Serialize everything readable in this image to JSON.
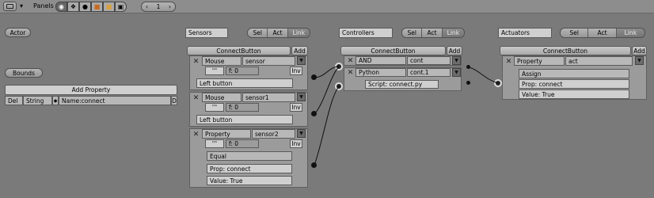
{
  "toolbar": {
    "window_icon": "window-type-icon",
    "panels_label": "Panels",
    "page_value": "1"
  },
  "actor": {
    "actor_button": "Actor",
    "bounds_button": "Bounds"
  },
  "properties": {
    "add_button": "Add Property",
    "row": {
      "del": "Del",
      "type": "String",
      "name": "Name:connect",
      "debug": "D"
    }
  },
  "sensors": {
    "title": "Sensors",
    "tabs": [
      "Sel",
      "Act",
      "Link"
    ],
    "connect_button": "ConnectButton",
    "add_button": "Add",
    "items": [
      {
        "type": "Mouse",
        "name": "sensor",
        "pulse": "'''",
        "freq": "f: 0",
        "inv": "Inv",
        "mode": "Left button"
      },
      {
        "type": "Mouse",
        "name": "sensor1",
        "pulse": "'''",
        "freq": "f: 0",
        "inv": "Inv",
        "mode": "Left button"
      },
      {
        "type": "Property",
        "name": "sensor2",
        "pulse": "'''",
        "freq": "f: 0",
        "inv": "Inv",
        "mode": "Equal",
        "prop": "Prop: connect",
        "value": "Value: True"
      }
    ]
  },
  "controllers": {
    "title": "Controllers",
    "tabs": [
      "Sel",
      "Act",
      "Link"
    ],
    "connect_button": "ConnectButton",
    "add_button": "Add",
    "items": [
      {
        "type": "AND",
        "name": "cont"
      },
      {
        "type": "Python",
        "name": "cont.1",
        "script": "Script: connect.py"
      }
    ]
  },
  "actuators": {
    "title": "Actuators",
    "tabs": [
      "Sel",
      "Act",
      "Link"
    ],
    "connect_button": "ConnectButton",
    "add_button": "Add",
    "items": [
      {
        "type": "Property",
        "name": "act",
        "mode": "Assign",
        "prop": "Prop: connect",
        "value": "Value: True"
      }
    ]
  },
  "colors": {
    "background": "#7a7a7a",
    "panel": "#9b9b9b",
    "header": "#b9b9b9",
    "link": "#111111"
  }
}
